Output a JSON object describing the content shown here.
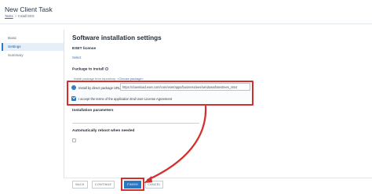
{
  "window": {
    "title": "New Client Task"
  },
  "breadcrumb": {
    "root": "Tasks",
    "separator": ">",
    "current": "Install EES"
  },
  "sidebar": {
    "items": [
      {
        "label": "Basic"
      },
      {
        "label": "Settings",
        "active": true
      },
      {
        "label": "Summary"
      }
    ]
  },
  "main": {
    "section_title": "Software installation settings",
    "eset_license": {
      "label": "ESET license",
      "link": "Select"
    },
    "package": {
      "label": "Package to install",
      "repository_prefix": "Install package from repository:",
      "repository_link": "<Choose package>",
      "direct_url_option": "Install by direct package URL",
      "direct_url_value": "https://download.eset.com/com/eset/apps/business/ees/windows/latest/ees_nt64",
      "eula_label": "I accept the terms of the application End User License Agreement",
      "eula_checked": true
    },
    "installation_parameters": {
      "label": "Installation parameters",
      "value": ""
    },
    "reboot": {
      "label": "Automatically reboot when needed",
      "checked": false
    }
  },
  "footer": {
    "back": "BACK",
    "continue": "CONTINUE",
    "finish": "FINISH",
    "cancel": "CANCEL"
  },
  "colors": {
    "accent": "#2b78c2",
    "highlight": "#d32f2f"
  }
}
